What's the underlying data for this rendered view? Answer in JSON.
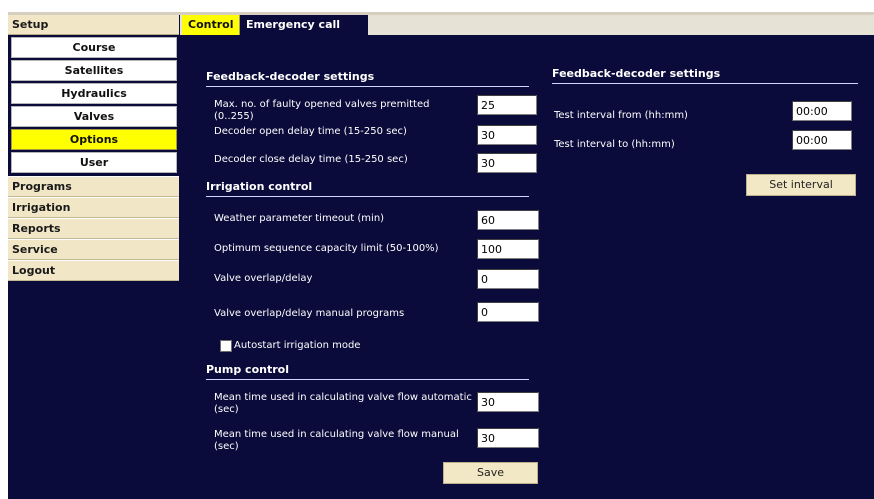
{
  "sidebar": {
    "setup_label": "Setup",
    "sub_items": [
      "Course",
      "Satellites",
      "Hydraulics",
      "Valves",
      "Options",
      "User"
    ],
    "active_sub_item": "Options",
    "items": [
      "Programs",
      "Irrigation",
      "Reports",
      "Service",
      "Logout"
    ]
  },
  "tabs": [
    "Control",
    "Emergency call"
  ],
  "active_tab": "Control",
  "left": {
    "feedback": {
      "title": "Feedback-decoder settings",
      "max_faulty_label": "Max. no. of faulty opened valves premitted (0..255)",
      "max_faulty_value": "25",
      "open_delay_label": "Decoder open delay time (15-250 sec)",
      "open_delay_value": "30",
      "close_delay_label": "Decoder close delay time (15-250 sec)",
      "close_delay_value": "30"
    },
    "irrigation": {
      "title": "Irrigation control",
      "weather_label": "Weather parameter timeout (min)",
      "weather_value": "60",
      "optimum_label": "Optimum sequence capacity limit (50-100%)",
      "optimum_value": "100",
      "overlap_label": "Valve overlap/delay",
      "overlap_value": "0",
      "overlap_manual_label": "Valve overlap/delay manual programs",
      "overlap_manual_value": "0",
      "autostart_label": "Autostart irrigation mode",
      "autostart_checked": false
    },
    "pump": {
      "title": "Pump control",
      "flow_auto_label": "Mean time used in calculating valve flow automatic (sec)",
      "flow_auto_value": "30",
      "flow_manual_label": "Mean time used in calculating valve flow manual (sec)",
      "flow_manual_value": "30"
    },
    "save_label": "Save"
  },
  "right": {
    "title": "Feedback-decoder settings",
    "from_label": "Test interval from (hh:mm)",
    "from_value": "00:00",
    "to_label": "Test interval to (hh:mm)",
    "to_value": "00:00",
    "set_interval_label": "Set interval"
  },
  "colors": {
    "background": "#0b0b3b",
    "active_highlight": "#ffff00",
    "sidebar_bg": "#f1e6c6"
  }
}
